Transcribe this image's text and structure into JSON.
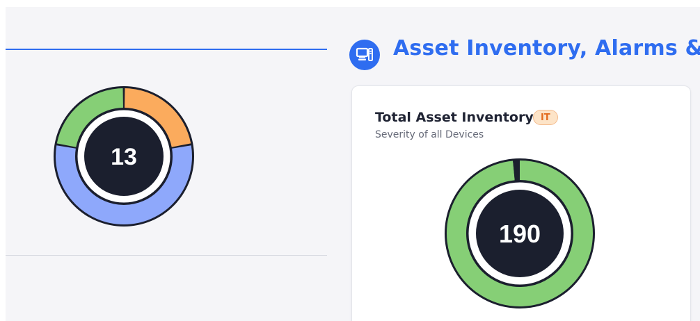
{
  "colors": {
    "page_background": "#f5f5f8",
    "accent_blue": "#2f6df0",
    "divider": "#d6d9e0",
    "donut_dark": "#1b1f2e",
    "donut_white": "#ffffff",
    "segment_green": "#86cf76",
    "segment_orange": "#fbab5d",
    "segment_blue": "#8ea8fb",
    "badge_background": "#fde4c8",
    "badge_text": "#e36b1e"
  },
  "left_panel": {
    "donut": {
      "center_value": "13",
      "segments": [
        {
          "color_key": "segment_orange",
          "fraction": 0.222
        },
        {
          "color_key": "segment_blue",
          "fraction": 0.556
        },
        {
          "color_key": "segment_green",
          "fraction": 0.222
        }
      ]
    }
  },
  "section": {
    "icon": "desktop-computer-icon",
    "title": "Asset Inventory, Alarms & Compliance"
  },
  "card": {
    "title": "Total Asset Inventory",
    "badge": "IT",
    "subtitle": "Severity of all Devices",
    "donut": {
      "center_value": "190",
      "segments": [
        {
          "color_key": "segment_green",
          "fraction": 0.985
        },
        {
          "color_key": "donut_dark",
          "fraction": 0.015
        }
      ]
    }
  }
}
